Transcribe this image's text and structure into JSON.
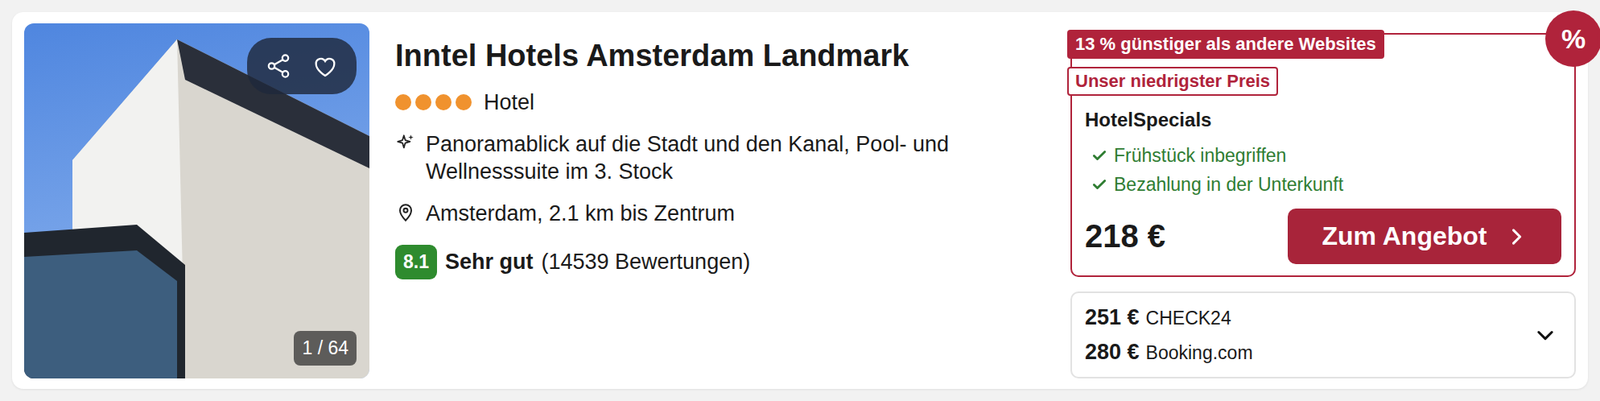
{
  "hotel": {
    "name": "Inntel Hotels Amsterdam Landmark",
    "stars": 4,
    "type": "Hotel",
    "highlight": "Panoramablick auf die Stadt und den Kanal, Pool- und Wellnesssuite im 3. Stock",
    "location": "Amsterdam, 2.1 km bis Zentrum",
    "favorite": false,
    "photo_counter": "1 / 64"
  },
  "rating": {
    "score": "8.1",
    "label": "Sehr gut",
    "count": "(14539 Bewertungen)"
  },
  "deal": {
    "discount_badge": "13 % günstiger als andere Websites",
    "lowest_badge": "Unser niedrigster Preis",
    "corner_badge": "%",
    "provider": "HotelSpecials",
    "features": [
      {
        "label": "Frühstück inbegriffen",
        "included": true
      },
      {
        "label": "Bezahlung in der Unterkunft",
        "included": true
      }
    ],
    "price": "218 €",
    "button": "Zum Angebot"
  },
  "other_offers": {
    "expanded": false,
    "items": [
      {
        "price": "251 €",
        "provider": "CHECK24"
      },
      {
        "price": "280 €",
        "provider": "Booking.com"
      }
    ]
  }
}
